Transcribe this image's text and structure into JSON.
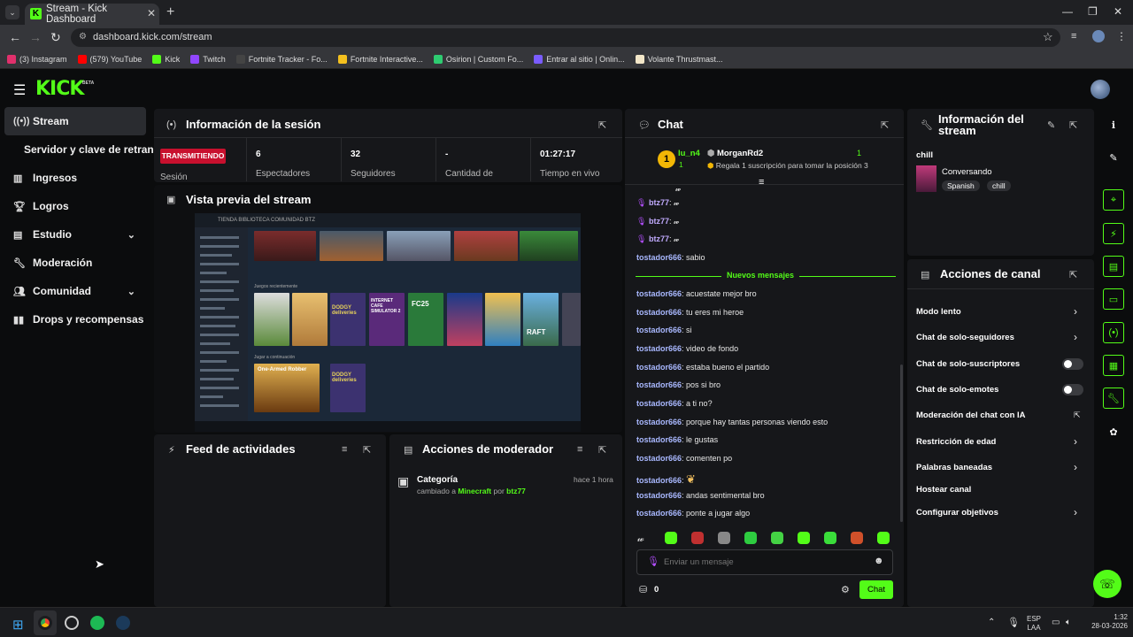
{
  "browser": {
    "tab_title": "Stream - Kick Dashboard",
    "url": "dashboard.kick.com/stream",
    "bookmarks": [
      {
        "label": "(3) Instagram",
        "color": "#e1306c"
      },
      {
        "label": "(579) YouTube",
        "color": "#ff0000"
      },
      {
        "label": "Kick",
        "color": "#53fc18"
      },
      {
        "label": "Twitch",
        "color": "#9146ff"
      },
      {
        "label": "Fortnite Tracker - Fo...",
        "color": "#444"
      },
      {
        "label": "Fortnite Interactive...",
        "color": "#f4c01e"
      },
      {
        "label": "Osirion | Custom Fo...",
        "color": "#2ecc71"
      },
      {
        "label": "Entrar al sitio | Onlin...",
        "color": "#7a5cff"
      },
      {
        "label": "Volante Thrustmast...",
        "color": "#f2e6c8"
      }
    ]
  },
  "kick": {
    "logo": "KICK",
    "beta": "BETA",
    "accent": "#53fc18"
  },
  "sidebar": {
    "items": [
      {
        "label": "Stream",
        "icon": "broadcast-icon"
      },
      {
        "label": "Servidor y clave de retransmisión"
      },
      {
        "label": "Ingresos",
        "icon": "chart-icon"
      },
      {
        "label": "Logros",
        "icon": "trophy-icon"
      },
      {
        "label": "Estudio",
        "icon": "studio-icon"
      },
      {
        "label": "Moderación",
        "icon": "wrench-icon"
      },
      {
        "label": "Comunidad",
        "icon": "community-icon"
      },
      {
        "label": "Drops y recompensas",
        "icon": "drops-icon"
      }
    ]
  },
  "session": {
    "title": "Información de la sesión",
    "live_badge": "TRANSMITIENDO",
    "session_label": "Sesión",
    "stats": [
      {
        "value": "6",
        "label": "Espectadores"
      },
      {
        "value": "32",
        "label": "Seguidores"
      },
      {
        "value": "-",
        "label": "Cantidad de"
      },
      {
        "value": "01:27:17",
        "label": "Tiempo en vivo"
      }
    ]
  },
  "preview": {
    "title": "Vista previa del stream",
    "store_tabs": "TIENDA   BIBLIOTECA   COMUNIDAD   BTZ",
    "games": [
      "DODGY deliveries",
      "INTERNET CAFE SIMULATOR 2",
      "FC25",
      "RAFT",
      "One-Armed Robber",
      "DODGY deliveries"
    ],
    "section_recent": "Juegos recientemente",
    "section_continue": "Jugar a continuación"
  },
  "feed": {
    "title": "Feed de actividades"
  },
  "modactions": {
    "title": "Acciones de moderador",
    "item_title": "Categoría",
    "item_time": "hace 1 hora",
    "item_prefix": "cambiado a",
    "item_category": "Minecraft",
    "item_by": "por",
    "item_user": "btz77"
  },
  "chat": {
    "title": "Chat",
    "top_rank": "1",
    "top_user": "lu_n4",
    "top_count": "1",
    "second_user": "MorganRd2",
    "second_count": "1",
    "gift_text": "Regala 1 suscripción para tomar la posición 3",
    "new_messages": "Nuevos mensajes",
    "messages_before": [
      {
        "user": "btz77",
        "text": ""
      },
      {
        "user": "btz77",
        "text": ""
      },
      {
        "user": "btz77",
        "text": ""
      },
      {
        "user": "tostador666",
        "text": "sabio"
      }
    ],
    "messages": [
      {
        "user": "tostador666",
        "text": "acuestate mejor bro"
      },
      {
        "user": "tostador666",
        "text": "tu eres mi heroe"
      },
      {
        "user": "tostador666",
        "text": "si"
      },
      {
        "user": "tostador666",
        "text": "video de fondo"
      },
      {
        "user": "tostador666",
        "text": "estaba bueno el partido"
      },
      {
        "user": "tostador666",
        "text": "pos si bro"
      },
      {
        "user": "tostador666",
        "text": "a ti no?"
      },
      {
        "user": "tostador666",
        "text": "porque hay tantas personas viendo esto"
      },
      {
        "user": "tostador666",
        "text": "le gustas"
      },
      {
        "user": "tostador666",
        "text": "comenten po"
      },
      {
        "user": "tostador666",
        "text": ""
      },
      {
        "user": "tostador666",
        "text": "andas sentimental bro"
      },
      {
        "user": "tostador666",
        "text": "ponte a jugar algo"
      }
    ],
    "input_placeholder": "Enviar un mensaje",
    "points": "0",
    "send_label": "Chat"
  },
  "stream_info": {
    "title": "Información del stream",
    "stream_title": "chill",
    "category": "Conversando",
    "tags": [
      "Spanish",
      "chill"
    ]
  },
  "channel_actions": {
    "title": "Acciones de canal",
    "items": [
      {
        "label": "Modo lento",
        "control": "arrow"
      },
      {
        "label": "Chat de solo-seguidores",
        "control": "arrow"
      },
      {
        "label": "Chat de solo-suscriptores",
        "control": "toggle"
      },
      {
        "label": "Chat de solo-emotes",
        "control": "toggle"
      },
      {
        "label": "Moderación del chat con IA",
        "control": "external"
      },
      {
        "label": "Restricción de edad",
        "control": "arrow"
      },
      {
        "label": "Palabras baneadas",
        "control": "arrow"
      },
      {
        "label": "Hostear canal",
        "control": "none"
      },
      {
        "label": "Configurar objetivos",
        "control": "arrow"
      }
    ]
  },
  "taskbar": {
    "lang": "ESP",
    "region": "LAA",
    "time": "1:32",
    "date": "28-03-2026"
  }
}
